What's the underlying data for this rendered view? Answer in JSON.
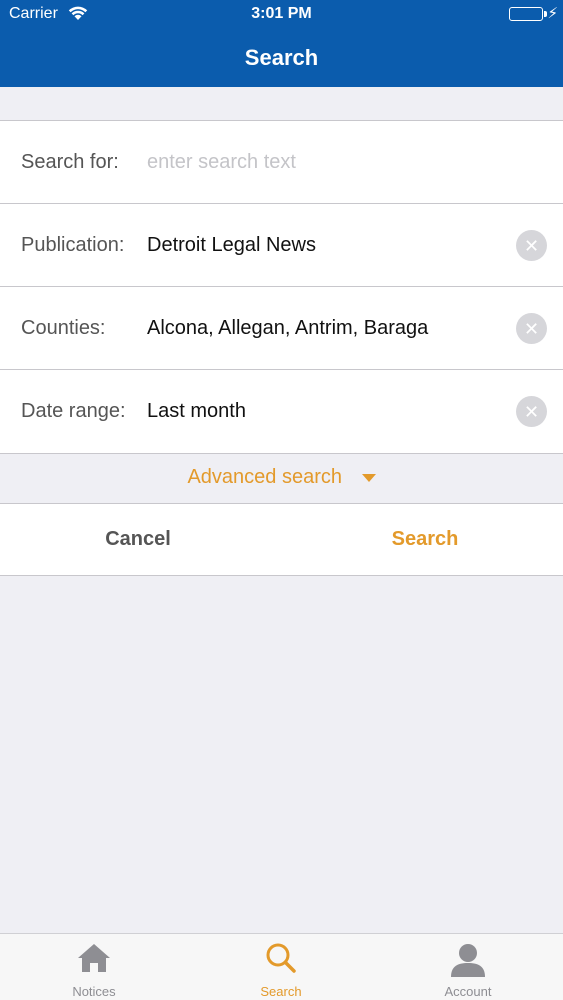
{
  "status_bar": {
    "carrier": "Carrier",
    "time": "3:01 PM"
  },
  "nav": {
    "title": "Search"
  },
  "form": {
    "search_for": {
      "label": "Search for:",
      "placeholder": "enter search text",
      "value": ""
    },
    "publication": {
      "label": "Publication:",
      "value": "Detroit Legal News"
    },
    "counties": {
      "label": "Counties:",
      "value": "Alcona, Allegan, Antrim, Baraga"
    },
    "date_range": {
      "label": "Date range:",
      "value": "Last month"
    },
    "clear_glyph": "✕"
  },
  "advanced_search": {
    "label": "Advanced search"
  },
  "actions": {
    "cancel_label": "Cancel",
    "search_label": "Search"
  },
  "tab_bar": {
    "items": [
      {
        "label": "Notices",
        "icon": "home-icon",
        "active": false
      },
      {
        "label": "Search",
        "icon": "search-icon",
        "active": true
      },
      {
        "label": "Account",
        "icon": "account-icon",
        "active": false
      }
    ]
  },
  "colors": {
    "brand_blue": "#0b5cad",
    "accent_orange": "#e39a2b",
    "battery_green": "#4cd964"
  }
}
